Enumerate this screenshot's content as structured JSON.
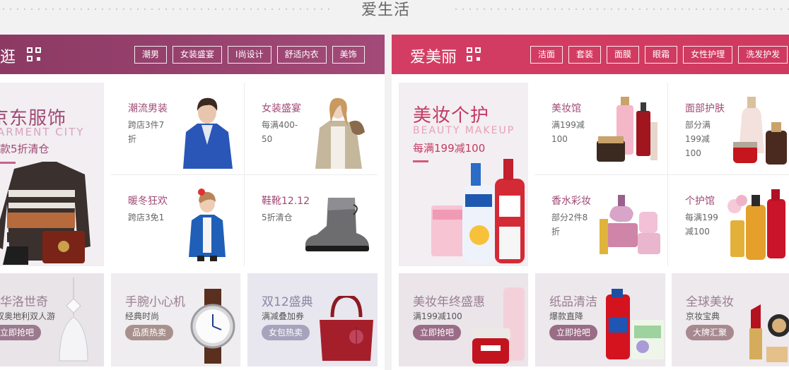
{
  "section_title": "爱生活",
  "left": {
    "title": "逛",
    "tags": [
      "潮男",
      "女装盛宴",
      "I尚设计",
      "舒适内衣",
      "美饰"
    ],
    "banner": {
      "title": "京东服饰",
      "subtitle": "ARMENT CITY",
      "promo": "款5折清仓"
    },
    "cells": [
      {
        "title": "潮流男装",
        "desc": "跨店3件7折"
      },
      {
        "title": "女装盛宴",
        "desc": "每满400-50"
      },
      {
        "title": "暖冬狂欢",
        "desc": "跨店3免1"
      },
      {
        "title": "鞋靴12.12",
        "desc": "5折清仓"
      }
    ],
    "cards": [
      {
        "title": "华洛世奇",
        "desc": "双奥地利双人游",
        "button": "立即抢吧"
      },
      {
        "title": "手腕小心机",
        "desc": "经典时尚",
        "button": "品质热卖"
      },
      {
        "title": "双12盛典",
        "desc": "满减叠加券",
        "button": "女包热卖"
      }
    ]
  },
  "right": {
    "title": "爱美丽",
    "tags": [
      "洁面",
      "套装",
      "面膜",
      "眼霜",
      "女性护理",
      "洗发护发"
    ],
    "banner": {
      "title": "美妆个护",
      "subtitle": "BEAUTY MAKEUP",
      "promo": "每满199减100"
    },
    "cells": [
      {
        "title": "美妆馆",
        "desc": "满199减100"
      },
      {
        "title": "面部护肤",
        "desc": "部分满199减100"
      },
      {
        "title": "香水彩妆",
        "desc": "部分2件8折"
      },
      {
        "title": "个护馆",
        "desc": "每满199减100"
      }
    ],
    "cards": [
      {
        "title": "美妆年终盛惠",
        "desc": "满199减100",
        "button": "立即抢吧"
      },
      {
        "title": "纸品清洁",
        "desc": "爆款直降",
        "button": "立即抢吧"
      },
      {
        "title": "全球美妆",
        "desc": "京妆宝典",
        "button": "大牌汇聚"
      }
    ]
  },
  "colors": {
    "left_header": "#9a4470",
    "right_header": "#d43d63",
    "accent_text": "#a04a76"
  },
  "icons": [
    "qr-code-icon"
  ]
}
